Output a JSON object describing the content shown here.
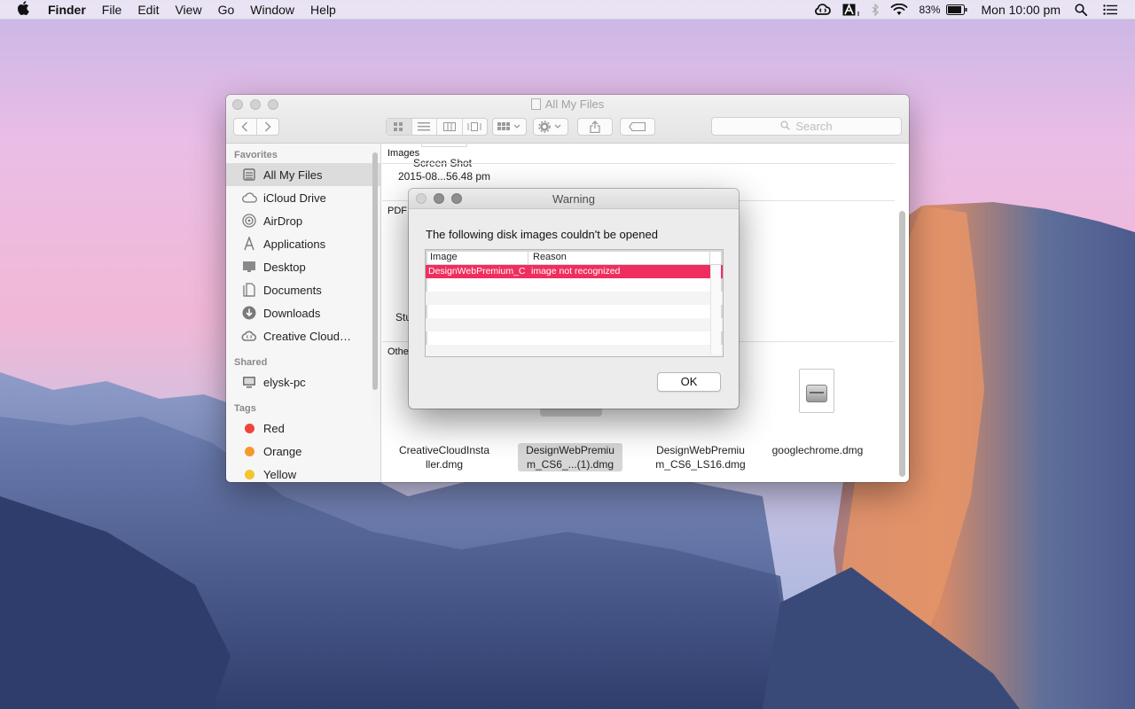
{
  "menubar": {
    "apple_icon": "apple-logo",
    "app_name": "Finder",
    "menus": [
      "File",
      "Edit",
      "View",
      "Go",
      "Window",
      "Help"
    ],
    "battery_percent": "83%",
    "clock": "Mon 10:00 pm",
    "status_icons": [
      "creative-cloud-icon",
      "adobe-icon",
      "bluetooth-icon",
      "wifi-icon",
      "battery-icon",
      "spotlight-icon",
      "notification-center-icon"
    ]
  },
  "finder": {
    "title": "All My Files",
    "search_placeholder": "Search",
    "sidebar": {
      "favorites_header": "Favorites",
      "favorites": [
        {
          "label": "All My Files",
          "icon": "all-files-icon",
          "selected": true
        },
        {
          "label": "iCloud Drive",
          "icon": "cloud-icon"
        },
        {
          "label": "AirDrop",
          "icon": "airdrop-icon"
        },
        {
          "label": "Applications",
          "icon": "applications-icon"
        },
        {
          "label": "Desktop",
          "icon": "desktop-icon"
        },
        {
          "label": "Documents",
          "icon": "documents-icon"
        },
        {
          "label": "Downloads",
          "icon": "downloads-icon"
        },
        {
          "label": "Creative Cloud…",
          "icon": "creative-cloud-icon"
        }
      ],
      "shared_header": "Shared",
      "shared": [
        {
          "label": "elysk-pc",
          "icon": "computer-icon"
        }
      ],
      "tags_header": "Tags",
      "tags": [
        {
          "label": "Red",
          "color": "#f0443a"
        },
        {
          "label": "Orange",
          "color": "#f39a2b"
        },
        {
          "label": "Yellow",
          "color": "#f2c52b"
        }
      ]
    },
    "content": {
      "images_header": "Images",
      "screenshot_name": "Screen Shot",
      "screenshot_date": "2015-08...56.48 pm",
      "pdf_header": "PDF",
      "pdf_partial": "Stu",
      "other_header": "Other",
      "files": [
        {
          "line1": "CreativeCloudInsta",
          "line2": "ller.dmg",
          "selected": false
        },
        {
          "line1": "DesignWebPremiu",
          "line2": "m_CS6_...(1).dmg",
          "selected": true
        },
        {
          "line1": "DesignWebPremiu",
          "line2": "m_CS6_LS16.dmg",
          "selected": false
        },
        {
          "line1": "googlechrome.dmg",
          "line2": "",
          "selected": false
        }
      ]
    }
  },
  "dialog": {
    "title": "Warning",
    "message": "The following disk images couldn't be opened",
    "columns": [
      "Image",
      "Reason"
    ],
    "rows": [
      {
        "image": "DesignWebPremium_C",
        "reason": "image not recognized"
      }
    ],
    "ok_label": "OK"
  }
}
